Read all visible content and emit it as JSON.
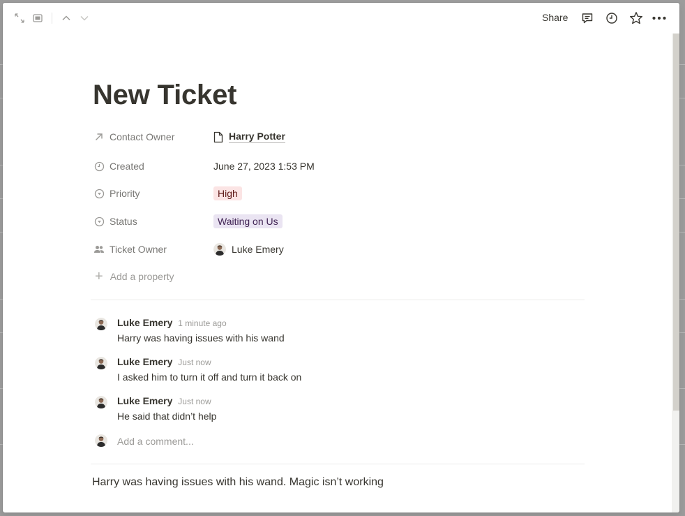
{
  "topbar": {
    "share_label": "Share",
    "icons": [
      "expand-icon",
      "peek-mode-icon",
      "chevron-up-icon",
      "chevron-down-icon",
      "comment-icon",
      "clock-icon",
      "star-icon",
      "more-icon"
    ]
  },
  "page": {
    "title": "New Ticket",
    "properties": [
      {
        "label": "Contact Owner",
        "value": "Harry Potter",
        "icon": "relation-arrow-icon"
      },
      {
        "label": "Created",
        "value": "June 27, 2023 1:53 PM",
        "icon": "clock-icon"
      },
      {
        "label": "Priority",
        "value": "High",
        "icon": "select-icon",
        "color": "#fbe4e4"
      },
      {
        "label": "Status",
        "value": "Waiting on Us",
        "icon": "select-icon",
        "color": "#eae4f2"
      },
      {
        "label": "Ticket Owner",
        "value": "Luke Emery",
        "icon": "people-icon"
      }
    ],
    "add_property_label": "Add a property"
  },
  "comments": [
    {
      "author": "Luke Emery",
      "time": "1 minute ago",
      "text": "Harry was having issues with his wand"
    },
    {
      "author": "Luke Emery",
      "time": "Just now",
      "text": "I asked him to turn it off and turn it back on"
    },
    {
      "author": "Luke Emery",
      "time": "Just now",
      "text": "He said that didn’t help"
    }
  ],
  "comment_input": {
    "placeholder": "Add a comment...",
    "value": ""
  },
  "body": {
    "text": "Harry was having issues with his wand. Magic isn’t working"
  }
}
